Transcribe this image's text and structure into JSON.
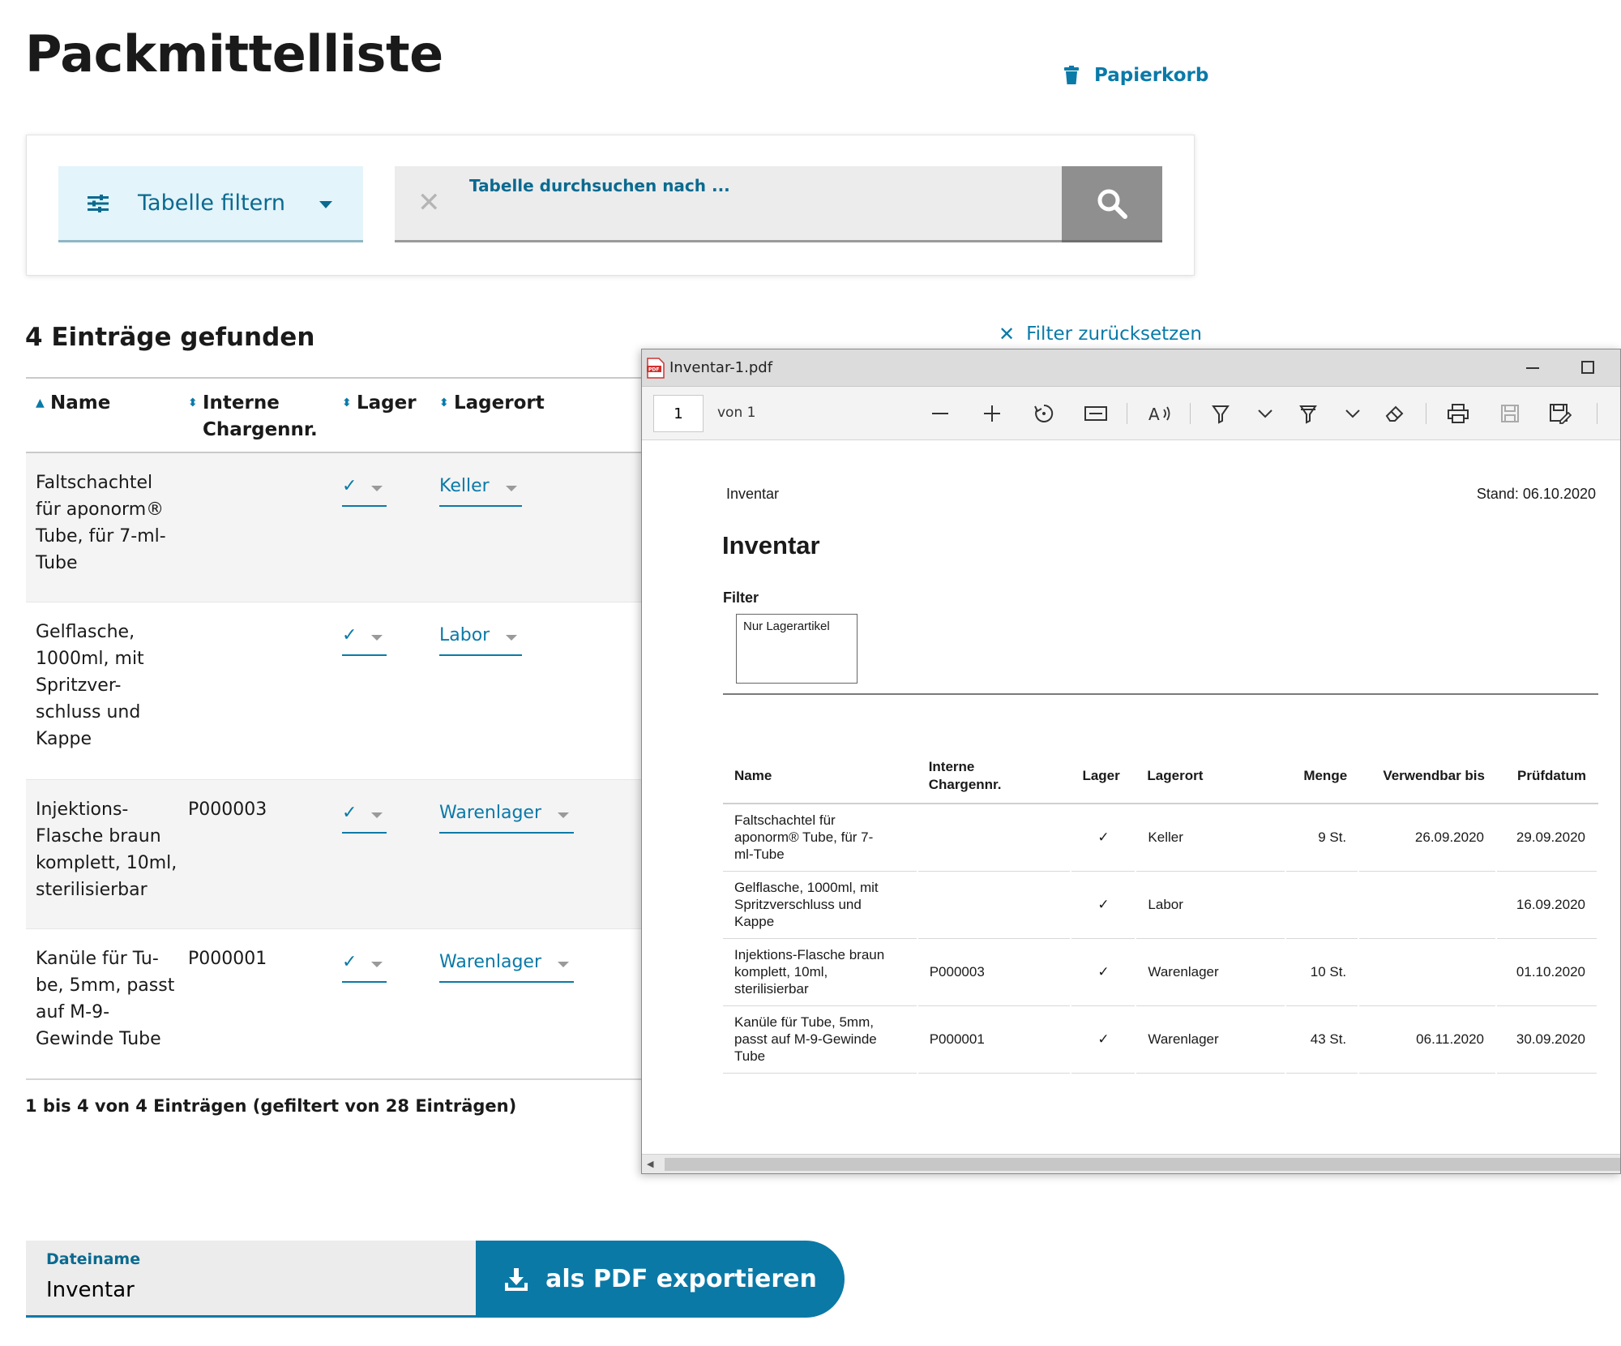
{
  "page": {
    "title": "Packmittelliste",
    "trash_label": "Papierkorb"
  },
  "filter": {
    "button_label": "Tabelle filtern",
    "search_label": "Tabelle durchsuchen nach ...",
    "search_value": ""
  },
  "results": {
    "count_text": "4 Einträge gefunden",
    "reset_label": "Filter zurücksetzen",
    "pagination": "1 bis 4 von 4 Einträgen (gefiltert von 28 Einträgen)"
  },
  "table": {
    "headers": {
      "name": "Name",
      "charge_1": "Interne",
      "charge_2": "Chargennr.",
      "lager": "Lager",
      "lagerort": "Lagerort"
    },
    "rows": [
      {
        "name_lines": [
          "Faltschachtel",
          "für aponorm®",
          "Tube, für 7-ml-",
          "Tube"
        ],
        "charge": "",
        "lager": "✓",
        "lagerort": "Keller"
      },
      {
        "name_lines": [
          "Gelflasche,",
          "1000ml, mit",
          "Spritzver-",
          "schluss und",
          "Kappe"
        ],
        "charge": "",
        "lager": "✓",
        "lagerort": "Labor"
      },
      {
        "name_lines": [
          "Injektions-",
          "Flasche braun",
          "komplett, 10ml,",
          "sterilisierbar"
        ],
        "charge": "P000003",
        "lager": "✓",
        "lagerort": "Warenlager"
      },
      {
        "name_lines": [
          "Kanüle für Tu-",
          "be, 5mm, passt",
          "auf M-9-",
          "Gewinde Tube"
        ],
        "charge": "P000001",
        "lager": "✓",
        "lagerort": "Warenlager"
      }
    ]
  },
  "export": {
    "filename_label": "Dateiname",
    "filename_value": "Inventar",
    "button_label": "als PDF exportieren"
  },
  "pdf_viewer": {
    "window_title": "Inventar-1.pdf",
    "page_number": "1",
    "page_of": "von 1",
    "doc": {
      "header_left": "Inventar",
      "header_right": "Stand: 06.10.2020",
      "heading": "Inventar",
      "filter_label": "Filter",
      "filter_value": "Nur Lagerartikel",
      "columns": {
        "name": "Name",
        "charge_1": "Interne",
        "charge_2": "Chargennr.",
        "lager": "Lager",
        "lagerort": "Lagerort",
        "menge": "Menge",
        "verwendbar": "Verwendbar bis",
        "pruefdatum": "Prüfdatum"
      },
      "rows": [
        {
          "name_lines": [
            "Faltschachtel für",
            "aponorm® Tube, für 7-",
            "ml-Tube"
          ],
          "charge": "",
          "lager": "✓",
          "lagerort": "Keller",
          "menge": "9 St.",
          "verwendbar": "26.09.2020",
          "pruefdatum": "29.09.2020"
        },
        {
          "name_lines": [
            "Gelflasche, 1000ml, mit",
            "Spritzverschluss und",
            "Kappe"
          ],
          "charge": "",
          "lager": "✓",
          "lagerort": "Labor",
          "menge": "",
          "verwendbar": "",
          "pruefdatum": "16.09.2020"
        },
        {
          "name_lines": [
            "Injektions-Flasche braun",
            "komplett, 10ml,",
            "sterilisierbar"
          ],
          "charge": "P000003",
          "lager": "✓",
          "lagerort": "Warenlager",
          "menge": "10 St.",
          "verwendbar": "",
          "pruefdatum": "01.10.2020"
        },
        {
          "name_lines": [
            "Kanüle für Tube, 5mm,",
            "passt auf M-9-Gewinde",
            "Tube"
          ],
          "charge": "P000001",
          "lager": "✓",
          "lagerort": "Warenlager",
          "menge": "43 St.",
          "verwendbar": "06.11.2020",
          "pruefdatum": "30.09.2020"
        }
      ]
    }
  },
  "colors": {
    "accent": "#0b79a6",
    "filter_bg": "#e3f4fa",
    "search_button": "#8f8f8f"
  }
}
